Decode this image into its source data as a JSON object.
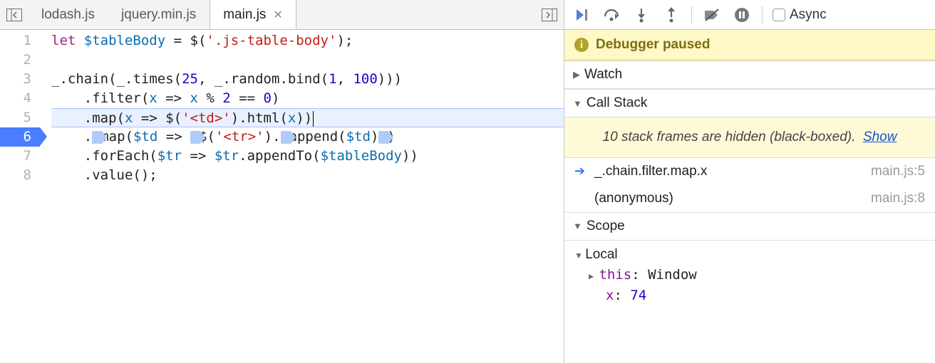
{
  "tabs": [
    {
      "label": "lodash.js",
      "active": false
    },
    {
      "label": "jquery.min.js",
      "active": false
    },
    {
      "label": "main.js",
      "active": true
    }
  ],
  "editor": {
    "lineNumbers": [
      "1",
      "2",
      "3",
      "4",
      "5",
      "6",
      "7",
      "8"
    ],
    "breakpointLine": 6,
    "highlightLine": 5,
    "code": {
      "l1": {
        "let": "let",
        "var": "$tableBody",
        "eq": " = ",
        "call": "$",
        "p1": "(",
        "str": "'.js-table-body'",
        "p2": ");"
      },
      "l3": {
        "pre": "_.",
        "chain": "chain",
        "p1": "(",
        "u": "_",
        "dot1": ".",
        "times": "times",
        "p2": "(",
        "n1": "25",
        "c1": ", ",
        "u2": "_",
        "dot2": ".",
        "rnd": "random",
        "dot3": ".",
        "bind": "bind",
        "p3": "(",
        "n2": "1",
        "c2": ", ",
        "n3": "100",
        "p4": ")))"
      },
      "l4": {
        "indent": "    .",
        "filter": "filter",
        "p1": "(",
        "x": "x",
        "arr": " => ",
        "expr_x": "x",
        "mod": " % ",
        "two": "2",
        "eq": " == ",
        "zero": "0",
        "p2": ")"
      },
      "l5": {
        "indent": "    .",
        "map": "map",
        "p1": "(",
        "x": "x",
        "arr": " => ",
        "dollar": "$",
        "p2": "(",
        "td": "'<td>'",
        "p3": ").",
        "html": "html",
        "p4": "(",
        "x2": "x",
        "p5": "))"
      },
      "l6": {
        "indent": "    .",
        "map": "map",
        "p1": "(",
        "td": "$td",
        "arr": " => ",
        "dollar": "$",
        "p2": "(",
        "tr": "'<tr>'",
        "p3": ").",
        "append": "append",
        "p4": "(",
        "td2": "$td",
        "p5": ")",
        "p6": ")"
      },
      "l7": {
        "indent": "    .",
        "foreach": "forEach",
        "p1": "(",
        "tr": "$tr",
        "arr": " => ",
        "tr2": "$tr",
        "dot": ".",
        "appendTo": "appendTo",
        "p2": "(",
        "body": "$tableBody",
        "p3": "))"
      },
      "l8": {
        "indent": "    .",
        "value": "value",
        "p": "();"
      }
    }
  },
  "debugger": {
    "pausedLabel": "Debugger paused",
    "watchLabel": "Watch",
    "callStackLabel": "Call Stack",
    "hiddenFramesMsg": "10 stack frames are hidden (black-boxed).",
    "hiddenFramesLink": "Show",
    "stack": [
      {
        "current": true,
        "fn": "_.chain.filter.map.x",
        "src": "main.js:5"
      },
      {
        "current": false,
        "fn": "(anonymous)",
        "src": "main.js:8"
      }
    ],
    "scopeLabel": "Scope",
    "scope": {
      "localLabel": "Local",
      "thisLabel": "this",
      "thisVal": "Window",
      "xLabel": "x",
      "xVal": "74"
    },
    "asyncLabel": "Async"
  }
}
